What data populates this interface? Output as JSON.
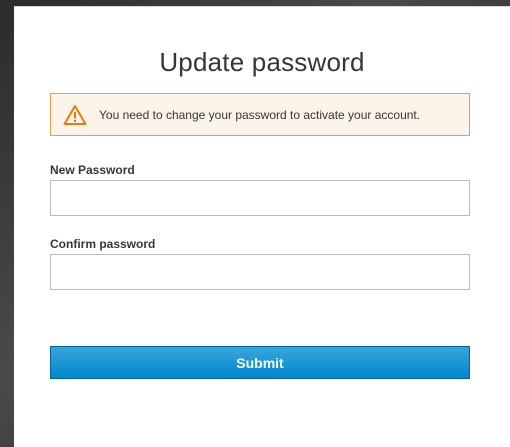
{
  "page": {
    "title": "Update password"
  },
  "alert": {
    "icon": "warning-icon",
    "message": "You need to change your password to activate your account.",
    "border_color": "#ec9b4e",
    "background_color": "#fdf4e9"
  },
  "form": {
    "new_password": {
      "label": "New Password",
      "value": "",
      "placeholder": ""
    },
    "confirm_password": {
      "label": "Confirm password",
      "value": "",
      "placeholder": ""
    },
    "submit_label": "Submit"
  },
  "colors": {
    "button_primary": "#0088ce",
    "text": "#363636"
  }
}
